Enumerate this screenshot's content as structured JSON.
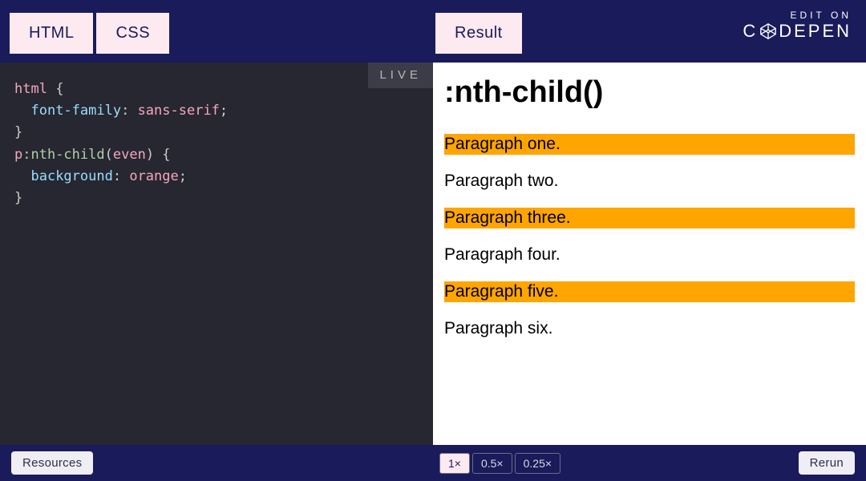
{
  "tabs": {
    "html": "HTML",
    "css": "CSS",
    "result": "Result"
  },
  "logo": {
    "edit_on": "EDIT ON",
    "brand": "C   DEPEN"
  },
  "editor": {
    "live_badge": "LIVE",
    "code": {
      "line1_tag": "html",
      "line1_brace": " {",
      "line2_indent": "  ",
      "line2_prop": "font-family",
      "line2_colon": ": ",
      "line2_val": "sans-serif",
      "line2_semi": ";",
      "line3_brace": "}",
      "line4_tag": "p",
      "line4_sel": ":nth-child",
      "line4_paren1": "(",
      "line4_arg": "even",
      "line4_paren2": ")",
      "line4_brace": " {",
      "line5_indent": "  ",
      "line5_prop": "background",
      "line5_colon": ": ",
      "line5_val": "orange",
      "line5_semi": ";",
      "line6_brace": "}"
    }
  },
  "result": {
    "heading": ":nth-child()",
    "p1": "Paragraph one.",
    "p2": "Paragraph two.",
    "p3": "Paragraph three.",
    "p4": "Paragraph four.",
    "p5": "Paragraph five.",
    "p6": "Paragraph six."
  },
  "footer": {
    "resources": "Resources",
    "zoom1": "1×",
    "zoom05": "0.5×",
    "zoom025": "0.25×",
    "rerun": "Rerun"
  }
}
